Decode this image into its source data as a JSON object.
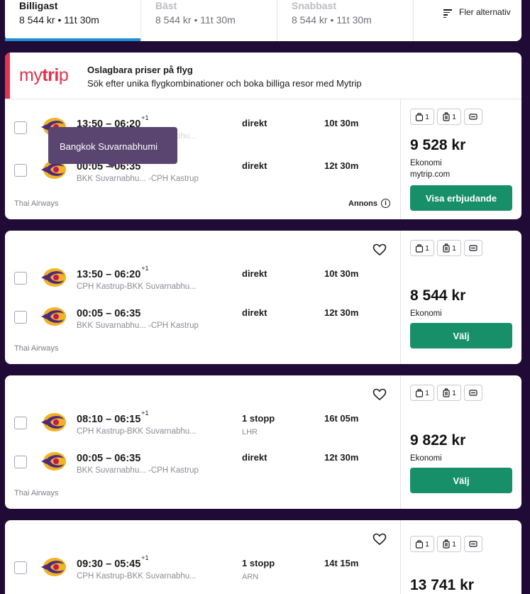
{
  "sort_tabs": [
    {
      "title": "Billigast",
      "summary": "8 544 kr • 11t 30m"
    },
    {
      "title": "Bäst",
      "summary": "8 544 kr • 11t 30m"
    },
    {
      "title": "Snabbast",
      "summary": "8 544 kr • 11t 30m"
    }
  ],
  "more_options": "Fler alternativ",
  "ad": {
    "logo": "mytrip",
    "title": "Oslagbara priser på flyg",
    "subtitle": "Sök efter unika flygkombinationer och boka billiga resor med Mytrip",
    "brand_color": "#e0324d"
  },
  "tooltip": "Bangkok Suvarnabhumi",
  "results": [
    {
      "legs": [
        {
          "times": "13:50 – 06:20",
          "day_offset": "+1",
          "route": "CPH Kastrup-BKK Suvarnabhu...",
          "stops": "direkt",
          "stop_airport": "",
          "duration": "10t 30m"
        },
        {
          "times": "00:05 – 06:35",
          "day_offset": "",
          "route": "BKK Suvarnabhu... -CPH Kastrup",
          "stops": "direkt",
          "stop_airport": "",
          "duration": "12t 30m"
        }
      ],
      "carrier": "Thai Airways",
      "annons": "Annons",
      "bags": {
        "personal": "1",
        "carry_on": "1"
      },
      "price": "9 528 kr",
      "cabin": "Ekonomi",
      "provider": "mytrip.com",
      "cta": "Visa erbjudande"
    },
    {
      "legs": [
        {
          "times": "13:50 – 06:20",
          "day_offset": "+1",
          "route": "CPH Kastrup-BKK Suvarnabhu...",
          "stops": "direkt",
          "stop_airport": "",
          "duration": "10t 30m"
        },
        {
          "times": "00:05 – 06:35",
          "day_offset": "",
          "route": "BKK Suvarnabhu... -CPH Kastrup",
          "stops": "direkt",
          "stop_airport": "",
          "duration": "12t 30m"
        }
      ],
      "carrier": "Thai Airways",
      "bags": {
        "personal": "1",
        "carry_on": "1"
      },
      "price": "8 544 kr",
      "cabin": "Ekonomi",
      "cta": "Välj"
    },
    {
      "legs": [
        {
          "times": "08:10 – 06:15",
          "day_offset": "+1",
          "route": "CPH Kastrup-BKK Suvarnabhu...",
          "stops": "1 stopp",
          "stop_airport": "LHR",
          "duration": "16t 05m"
        },
        {
          "times": "00:05 – 06:35",
          "day_offset": "",
          "route": "BKK Suvarnabhu... -CPH Kastrup",
          "stops": "direkt",
          "stop_airport": "",
          "duration": "12t 30m"
        }
      ],
      "carrier": "Thai Airways",
      "bags": {
        "personal": "1",
        "carry_on": "1"
      },
      "price": "9 822 kr",
      "cabin": "Ekonomi",
      "cta": "Välj"
    },
    {
      "legs": [
        {
          "times": "09:30 – 05:45",
          "day_offset": "+1",
          "route": "CPH Kastrup-BKK Suvarnabhu...",
          "stops": "1 stopp",
          "stop_airport": "ARN",
          "duration": "14t 15m"
        }
      ],
      "bags": {
        "personal": "1",
        "carry_on": "1"
      },
      "price": "13 741 kr"
    }
  ],
  "colors": {
    "page_background": "#1f0b35",
    "cta_green": "#17906a",
    "active_tab_underline": "#1a8fd6",
    "thai_purple": "#4e2a7a",
    "thai_gold": "#f0b323"
  }
}
